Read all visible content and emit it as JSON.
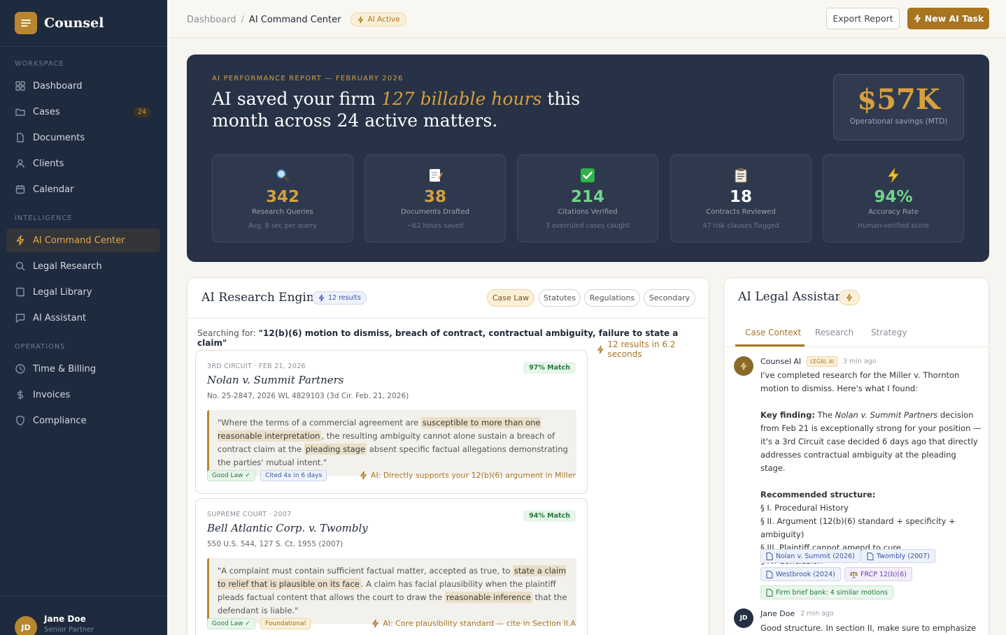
{
  "app": {
    "name": "Counsel"
  },
  "sidebar": {
    "sections": {
      "workspace": "WORKSPACE",
      "intelligence": "INTELLIGENCE",
      "operations": "OPERATIONS"
    },
    "items": [
      {
        "label": "Dashboard",
        "icon": "grid-icon"
      },
      {
        "label": "Cases",
        "icon": "folder-icon",
        "badge": "24"
      },
      {
        "label": "Documents",
        "icon": "document-icon"
      },
      {
        "label": "Clients",
        "icon": "user-icon"
      },
      {
        "label": "Calendar",
        "icon": "calendar-icon"
      },
      {
        "label": "AI Command Center",
        "icon": "bolt-icon",
        "active": true
      },
      {
        "label": "Legal Research",
        "icon": "search-icon"
      },
      {
        "label": "Legal Library",
        "icon": "book-icon"
      },
      {
        "label": "AI Assistant",
        "icon": "chat-icon"
      },
      {
        "label": "Time & Billing",
        "icon": "clock-icon"
      },
      {
        "label": "Invoices",
        "icon": "dollar-icon"
      },
      {
        "label": "Compliance",
        "icon": "shield-icon"
      }
    ],
    "user": {
      "initials": "JD",
      "name": "Jane Doe",
      "role": "Senior Partner"
    }
  },
  "topbar": {
    "breadcrumb_root": "Dashboard",
    "breadcrumb_sep": "/",
    "breadcrumb_current": "AI Command Center",
    "status_pill": "AI Active",
    "export_label": "Export Report",
    "new_task_label": "New AI Task"
  },
  "hero": {
    "kicker": "AI PERFORMANCE REPORT — FEBRUARY 2026",
    "title_pre": "AI saved your firm ",
    "title_em": "127 billable hours",
    "title_post": " this month across 24 active matters.",
    "savings_value": "$57K",
    "savings_label": "Operational savings (MTD)",
    "stats": [
      {
        "icon": "magnifier-icon",
        "value": "342",
        "label": "Research Queries",
        "sub": "Avg. 8 sec per query",
        "color": "#d79f3e"
      },
      {
        "icon": "memo-icon",
        "value": "38",
        "label": "Documents Drafted",
        "sub": "~62 hours saved",
        "color": "#d79f3e"
      },
      {
        "icon": "check-icon",
        "value": "214",
        "label": "Citations Verified",
        "sub": "3 overruled cases caught",
        "color": "#6fd58c"
      },
      {
        "icon": "clipboard-icon",
        "value": "18",
        "label": "Contracts Reviewed",
        "sub": "47 risk clauses flagged",
        "color": "#ffffff"
      },
      {
        "icon": "bolt-icon",
        "value": "94%",
        "label": "Accuracy Rate",
        "sub": "Human-verified score",
        "color": "#6fd58c"
      }
    ]
  },
  "research": {
    "title": "AI Research Engine",
    "results_pill": "12 results",
    "filters": [
      "Case Law",
      "Statutes",
      "Regulations",
      "Secondary"
    ],
    "active_filter": "Case Law",
    "search_label": "Searching for: ",
    "search_query": "\"12(b)(6) motion to dismiss, breach of contract, contractual ambiguity, failure to state a claim\"",
    "search_meta": "12 results in 6.2 seconds",
    "cases": [
      {
        "court": "3RD CIRCUIT · FEB 21, 2026",
        "match": "97% Match",
        "name": "Nolan v. Summit Partners",
        "cite": "No. 25-2847, 2026 WL 4829103 (3d Cir. Feb. 21, 2026)",
        "quote_parts": [
          "\"Where the terms of a commercial agreement are ",
          "susceptible to more than one reasonable interpretation",
          ", the resulting ambiguity cannot alone sustain a breach of contract claim at the ",
          "pleading stage",
          " absent specific factual allegations demonstrating the parties' mutual intent.\""
        ],
        "tags": [
          "Good Law ✓",
          "Cited 4x in 6 days"
        ],
        "ai_note": "AI: Directly supports your 12(b)(6) argument in Miller"
      },
      {
        "court": "SUPREME COURT · 2007",
        "match": "94% Match",
        "name": "Bell Atlantic Corp. v. Twombly",
        "cite": "550 U.S. 544, 127 S. Ct. 1955 (2007)",
        "quote_parts": [
          "\"A complaint must contain sufficient factual matter, accepted as true, to ",
          "state a claim to relief that is plausible on its face",
          ". A claim has facial plausibility when the plaintiff pleads factual content that allows the court to draw the ",
          "reasonable inference",
          " that the defendant is liable.\""
        ],
        "tags": [
          "Good Law ✓",
          "Foundational"
        ],
        "ai_note": "AI: Core plausibility standard — cite in Section II.A"
      }
    ]
  },
  "assistant": {
    "title": "AI Legal Assistant",
    "tabs": [
      "Case Context",
      "Research",
      "Strategy"
    ],
    "active_tab": "Case Context",
    "messages": [
      {
        "author": "Counsel AI",
        "tag": "LEGAL AI",
        "time": "3 min ago",
        "intro": "I've completed research for the Miller v. Thornton motion to dismiss. Here's what I found:",
        "key_label": "Key finding:",
        "key_pre": " The ",
        "key_case": "Nolan v. Summit Partners",
        "key_post": " decision from Feb 21 is exceptionally strong for your position — it's a 3rd Circuit case decided 6 days ago that directly addresses contractual ambiguity at the pleading stage.",
        "structure_label": "Recommended structure:",
        "structure": [
          "§ I. Procedural History",
          "§ II. Argument (12(b)(6) standard + specificity + ambiguity)",
          "§ III. Plaintiff cannot amend to cure",
          "§ IV. Conclusion"
        ],
        "chips": [
          "Nolan v. Summit (2026)",
          "Twombly (2007)",
          "Westbrook (2024)",
          "FRCP 12(b)(6)",
          "Firm brief bank: 4 similar motions"
        ]
      },
      {
        "author": "Jane Doe",
        "initials": "JD",
        "time": "2 min ago",
        "body": "Good structure. In section II, make sure to emphasize that"
      }
    ]
  }
}
